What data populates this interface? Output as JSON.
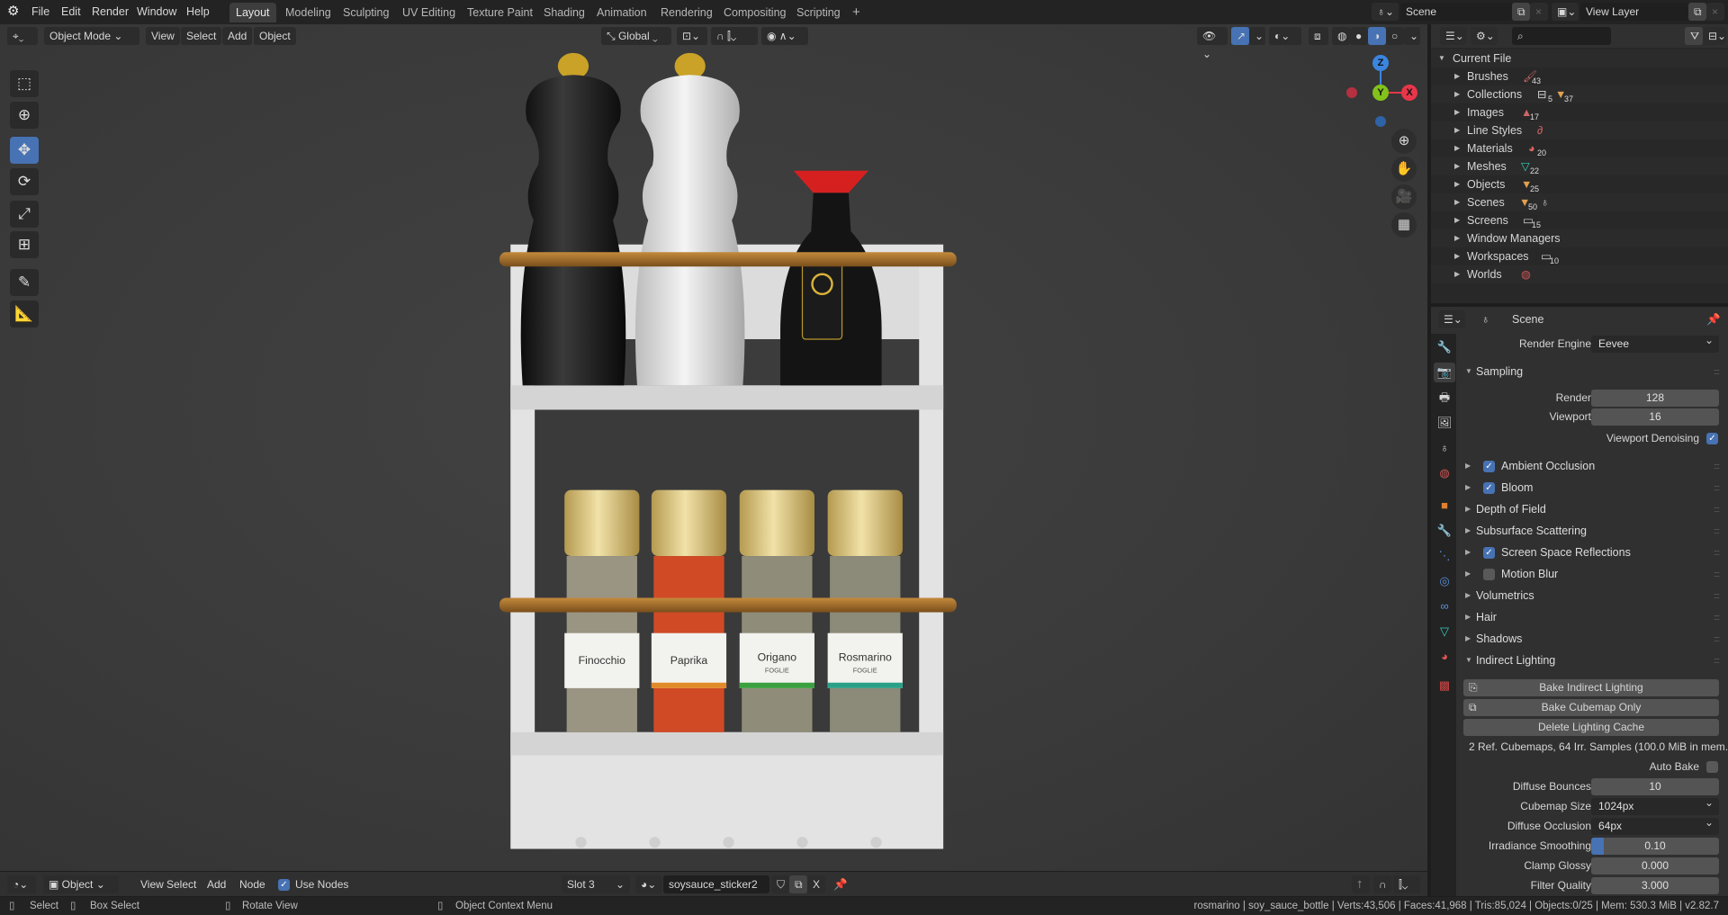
{
  "topbar": {
    "menus": [
      "File",
      "Edit",
      "Render",
      "Window",
      "Help"
    ],
    "workspaces": [
      "Layout",
      "Modeling",
      "Sculpting",
      "UV Editing",
      "Texture Paint",
      "Shading",
      "Animation",
      "Rendering",
      "Compositing",
      "Scripting"
    ],
    "add_tab": "+",
    "scene": "Scene",
    "view_layer": "View Layer"
  },
  "viewport": {
    "mode": "Object Mode",
    "menus": [
      "View",
      "Select",
      "Add",
      "Object"
    ],
    "transform_orientation": "Global",
    "gizmo": {
      "z": "Z",
      "y": "Y",
      "x": "X"
    },
    "scene_labels": [
      {
        "name": "Finocchio",
        "sub": ""
      },
      {
        "name": "Paprika",
        "sub": ""
      },
      {
        "name": "Origano",
        "sub": "FOGLIE"
      },
      {
        "name": "Rosmarino",
        "sub": "FOGLIE"
      }
    ]
  },
  "outliner": {
    "root": "Current File",
    "items": [
      {
        "label": "Brushes",
        "count": "43"
      },
      {
        "label": "Collections",
        "count": "5",
        "count2": "37"
      },
      {
        "label": "Images",
        "count": "17"
      },
      {
        "label": "Line Styles",
        "count": ""
      },
      {
        "label": "Materials",
        "count": "20"
      },
      {
        "label": "Meshes",
        "count": "22"
      },
      {
        "label": "Objects",
        "count": "25"
      },
      {
        "label": "Scenes",
        "count": "50"
      },
      {
        "label": "Screens",
        "count": "15"
      },
      {
        "label": "Window Managers",
        "count": ""
      },
      {
        "label": "Workspaces",
        "count": "10"
      },
      {
        "label": "Worlds",
        "count": ""
      }
    ]
  },
  "properties": {
    "context": "Scene",
    "render_engine_label": "Render Engine",
    "render_engine": "Eevee",
    "sampling": {
      "title": "Sampling",
      "render_label": "Render",
      "render": "128",
      "viewport_label": "Viewport",
      "viewport": "16",
      "denoise_label": "Viewport Denoising",
      "denoise": true
    },
    "panels": [
      {
        "label": "Ambient Occlusion",
        "checkbox": true
      },
      {
        "label": "Bloom",
        "checkbox": true
      },
      {
        "label": "Depth of Field"
      },
      {
        "label": "Subsurface Scattering"
      },
      {
        "label": "Screen Space Reflections",
        "checkbox": true
      },
      {
        "label": "Motion Blur",
        "checkbox": false
      },
      {
        "label": "Volumetrics"
      },
      {
        "label": "Hair"
      },
      {
        "label": "Shadows"
      }
    ],
    "indirect": {
      "title": "Indirect Lighting",
      "bake": "Bake Indirect Lighting",
      "bake_cube": "Bake Cubemap Only",
      "delete": "Delete Lighting Cache",
      "info": "2 Ref. Cubemaps, 64 Irr. Samples (100.0 MiB in mem..",
      "auto_bake_label": "Auto Bake",
      "auto_bake": false,
      "fields": [
        {
          "label": "Diffuse Bounces",
          "value": "10"
        },
        {
          "label": "Cubemap Size",
          "value": "1024px"
        },
        {
          "label": "Diffuse Occlusion",
          "value": "64px"
        },
        {
          "label": "Irradiance Smoothing",
          "value": "0.10",
          "fraction": 0.1
        },
        {
          "label": "Clamp Glossy",
          "value": "0.000"
        },
        {
          "label": "Filter Quality",
          "value": "3.000"
        }
      ]
    }
  },
  "shader_header": {
    "object": "Object",
    "menus": [
      "View",
      "Select",
      "Add",
      "Node"
    ],
    "use_nodes_label": "Use Nodes",
    "use_nodes": true,
    "slot": "Slot 3",
    "material": "soysauce_sticker2",
    "close": "X"
  },
  "statusbar": {
    "select": "Select",
    "box_select": "Box Select",
    "rotate": "Rotate View",
    "context_menu": "Object Context Menu",
    "stats": "rosmarino | soy_sauce_bottle | Verts:43,506 | Faces:41,968 | Tris:85,024 | Objects:0/25 | Mem: 530.3 MiB | v2.82.7"
  },
  "colors": {
    "accent": "#4772b3",
    "x_axis": "#e8364a",
    "y_axis": "#83c21b",
    "z_axis": "#3b85e0"
  }
}
